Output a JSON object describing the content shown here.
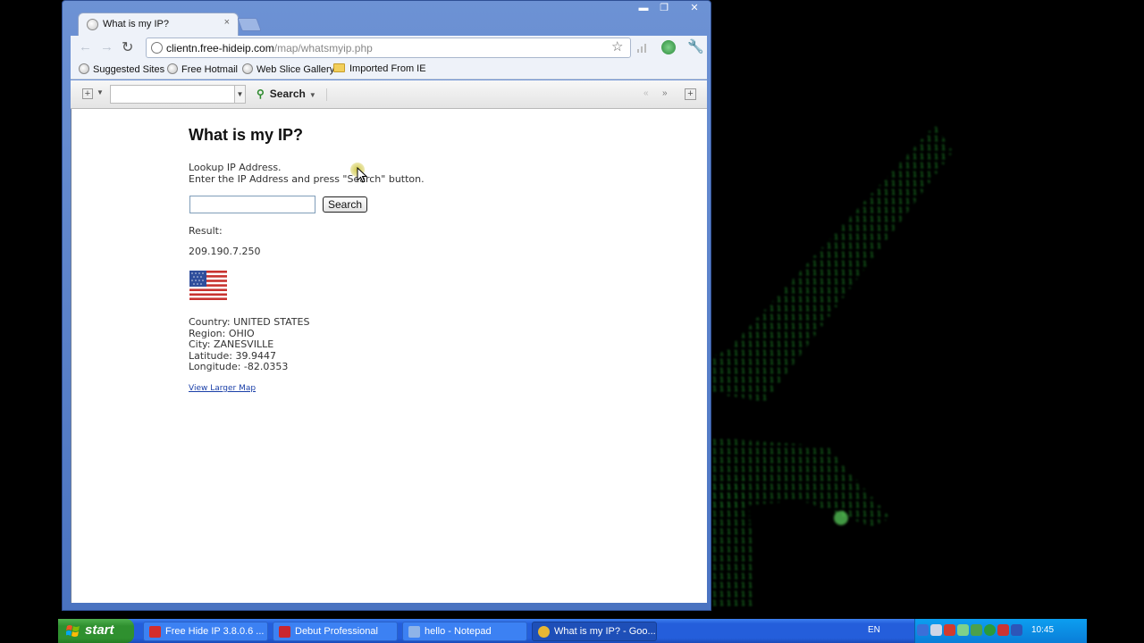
{
  "browser": {
    "tab_title": "What is my IP?",
    "tab_close": "×",
    "url_host": "clientn.free-hideip.com",
    "url_path": "/map/whatsmyip.php",
    "window_buttons": {
      "minimize": "▬",
      "maximize": "❐",
      "close": "✕"
    },
    "nav": {
      "back": "←",
      "forward": "→",
      "reload": "↻"
    },
    "bookmarks": [
      {
        "label": "Suggested Sites"
      },
      {
        "label": "Free Hotmail"
      },
      {
        "label": "Web Slice Gallery"
      },
      {
        "label": "Imported From IE"
      }
    ],
    "searchbar": {
      "search_label": "Search",
      "prev": "«",
      "next": "»",
      "add": "+"
    }
  },
  "page": {
    "title": "What is my IP?",
    "desc_line1": "Lookup IP Address.",
    "desc_line2": "Enter the IP Address and press \"Search\" button.",
    "search_button": "Search",
    "input_value": "",
    "result_label": "Result:",
    "ip": "209.190.7.250",
    "country": "Country: UNITED STATES",
    "region": "Region: OHIO",
    "city": "City: ZANESVILLE",
    "latitude": "Latitude: 39.9447",
    "longitude": "Longitude: -82.0353",
    "map_link": "View Larger Map"
  },
  "taskbar": {
    "start": "start",
    "tasks": [
      {
        "label": "Free Hide IP  3.8.0.6 ...",
        "icon": "free-hide-ip-icon",
        "color": "#d32d2d"
      },
      {
        "label": "Debut Professional",
        "icon": "debut-icon",
        "color": "#c9262f"
      },
      {
        "label": "hello - Notepad",
        "icon": "notepad-icon",
        "color": "#8fb4e8"
      },
      {
        "label": "What is my IP? - Goo...",
        "icon": "chrome-icon",
        "color": "#e8b733"
      }
    ],
    "language": "EN",
    "clock": "10:45"
  },
  "colors": {
    "window_frame": "#4a73c1",
    "taskbar": "#245edb",
    "start_green": "#2f902f",
    "tray": "#0a7ed8",
    "link": "#1a3fa8",
    "matrix_green": "#3cd64a"
  }
}
